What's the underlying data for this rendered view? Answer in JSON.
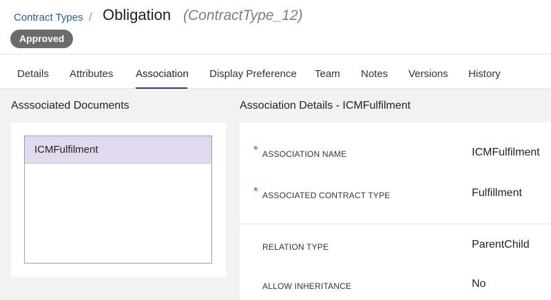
{
  "header": {
    "breadcrumb_link": "Contract Types",
    "breadcrumb_sep": "/",
    "title": "Obligation",
    "subtitle": "(ContractType_12)",
    "status": "Approved"
  },
  "tabs": [
    {
      "label": "Details"
    },
    {
      "label": "Attributes"
    },
    {
      "label": "Association"
    },
    {
      "label": "Display Preference"
    },
    {
      "label": "Team"
    },
    {
      "label": "Notes"
    },
    {
      "label": "Versions"
    },
    {
      "label": "History"
    }
  ],
  "active_tab": "Association",
  "associated_documents": {
    "title": "Asssociated Documents",
    "items": [
      "ICMFulfilment"
    ]
  },
  "association_details": {
    "title": "Association Details - ICMFulfilment",
    "fields": [
      {
        "label": "ASSOCIATION NAME",
        "value": "ICMFulfilment",
        "required": "*"
      },
      {
        "label": "ASSOCIATED CONTRACT TYPE",
        "value": "Fulfillment",
        "required": "*"
      },
      {
        "label": "RELATION TYPE",
        "value": "ParentChild"
      },
      {
        "label": "ALLOW INHERITANCE",
        "value": "No"
      }
    ]
  },
  "colors": {
    "accent": "#4b2e83",
    "link": "#1f5fa8",
    "badge": "#6b6b6b",
    "selected_row": "#e3d9ee",
    "required": "#e0282e"
  }
}
